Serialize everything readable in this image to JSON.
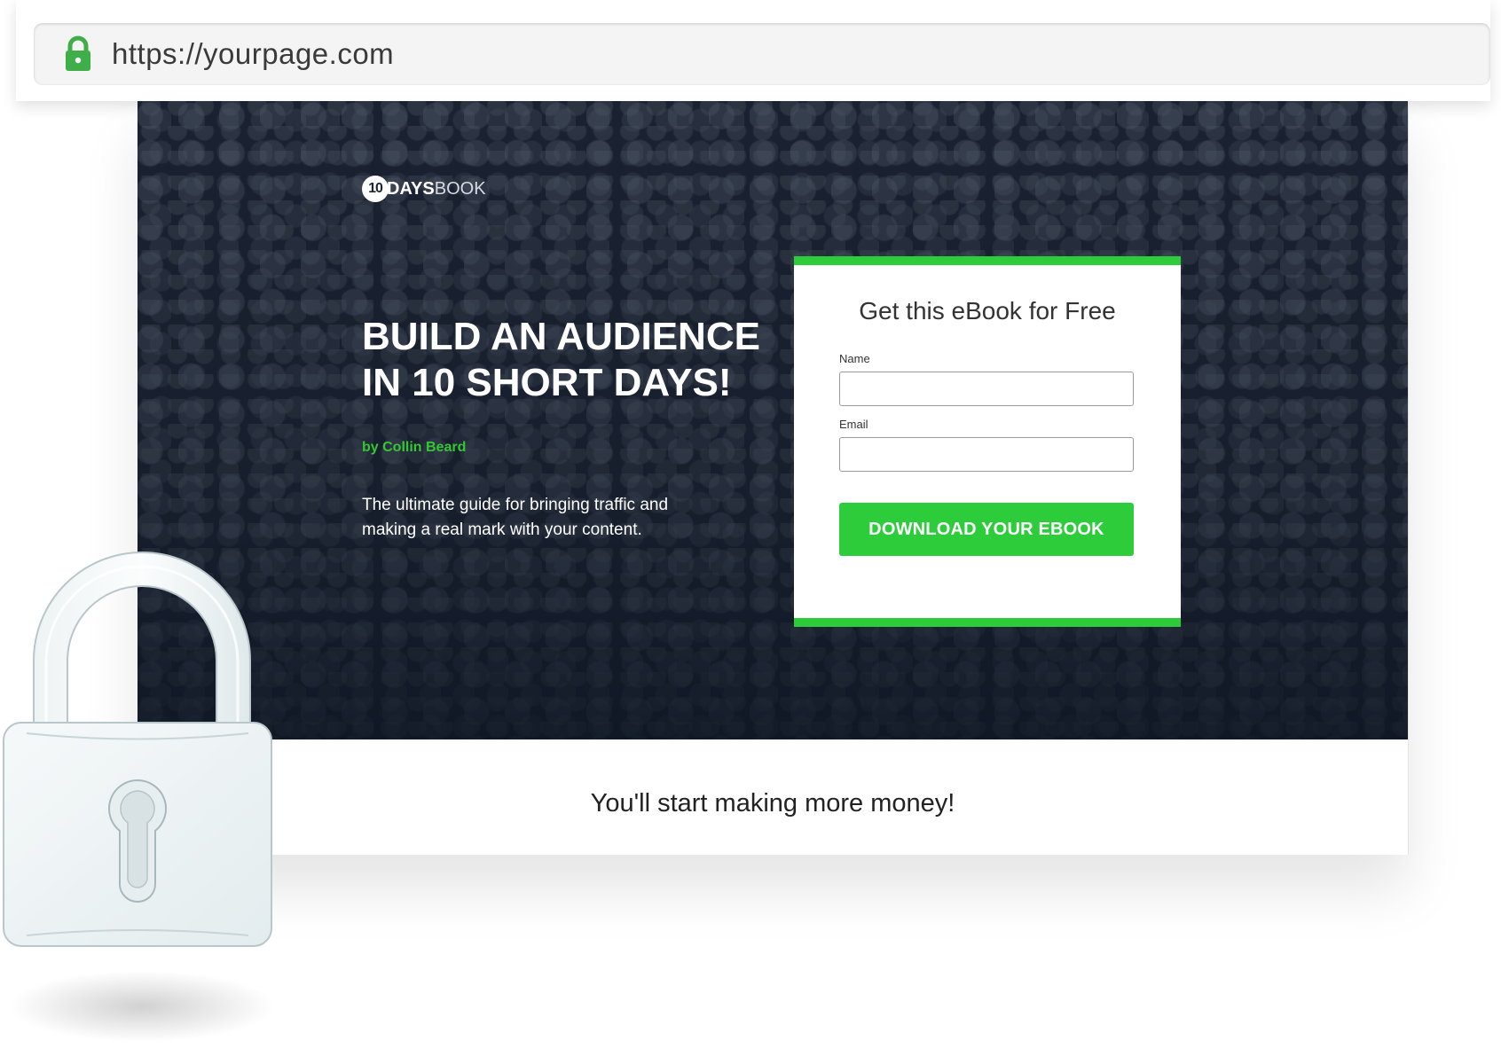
{
  "browser": {
    "url": "https://yourpage.com",
    "lock_icon": "padlock-icon",
    "lock_color": "#3fae49"
  },
  "hero": {
    "logo": {
      "number": "10",
      "days": "DAYS",
      "book": "BOOK"
    },
    "headline": [
      "BUILD AN AUDIENCE",
      "IN 10 SHORT DAYS!"
    ],
    "author": "by Collin Beard",
    "description": "The ultimate guide for bringing traffic and making a real mark with your content."
  },
  "form": {
    "title": "Get this eBook for Free",
    "name_label": "Name",
    "name_value": "",
    "email_label": "Email",
    "email_value": "",
    "cta_label": "DOWNLOAD YOUR EBOOK",
    "accent_color": "#2ccc3a"
  },
  "tagline": "You'll start making more money!",
  "decor": {
    "big_lock_icon": "padlock-illustration-icon"
  }
}
